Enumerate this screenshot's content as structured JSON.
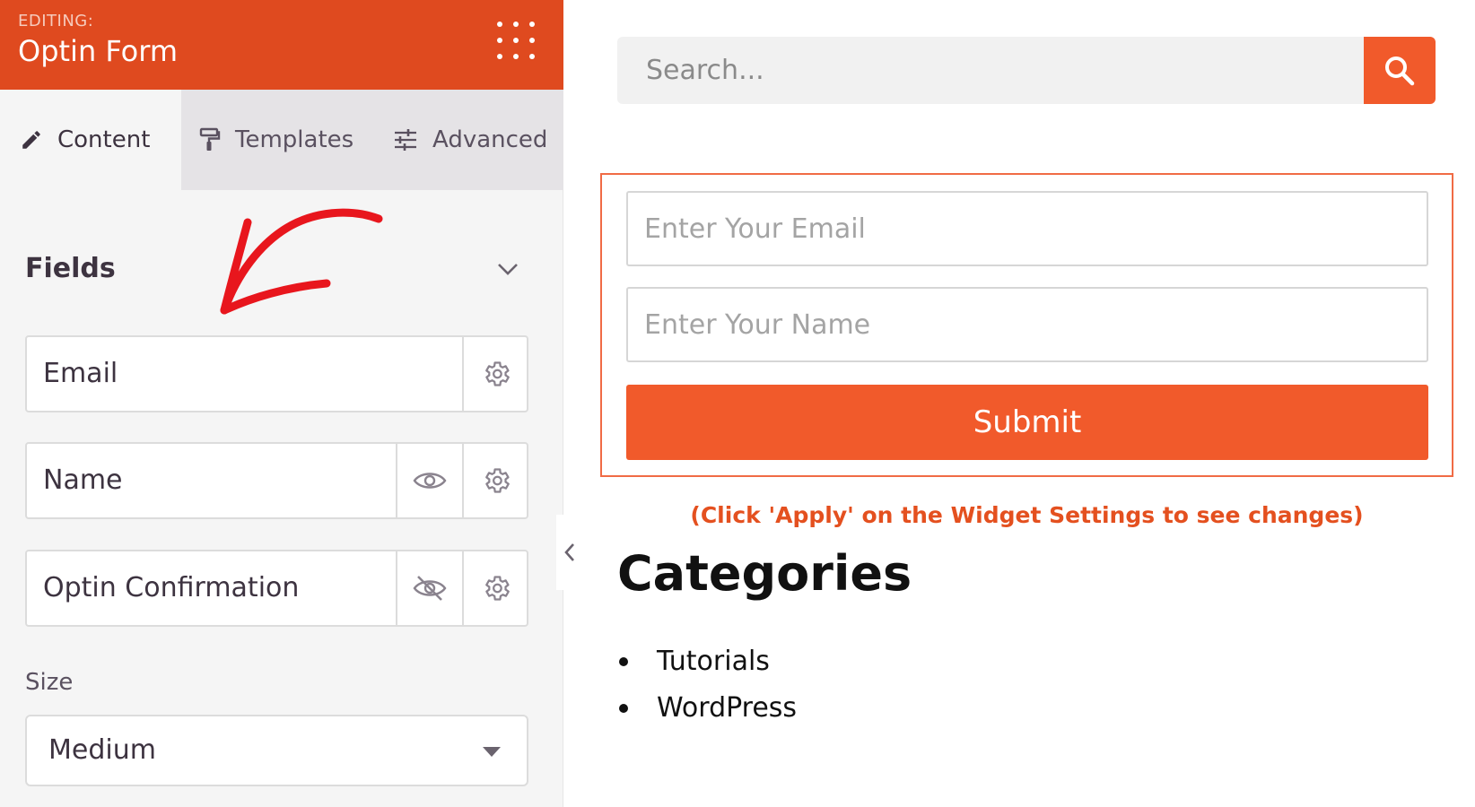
{
  "editor": {
    "editing_label": "EDITING:",
    "title": "Optin Form"
  },
  "tabs": [
    {
      "label": "Content",
      "icon": "pencil-icon",
      "active": true
    },
    {
      "label": "Templates",
      "icon": "paint-roller-icon",
      "active": false
    },
    {
      "label": "Advanced",
      "icon": "sliders-icon",
      "active": false
    }
  ],
  "fields_section": {
    "title": "Fields",
    "items": [
      {
        "label": "Email",
        "visibility_icon": null
      },
      {
        "label": "Name",
        "visibility_icon": "eye-icon"
      },
      {
        "label": "Optin Confirmation",
        "visibility_icon": "eye-slash-icon"
      }
    ]
  },
  "size": {
    "label": "Size",
    "value": "Medium"
  },
  "preview": {
    "search_placeholder": "Search...",
    "email_placeholder": "Enter Your Email",
    "name_placeholder": "Enter Your Name",
    "submit_label": "Submit",
    "apply_note": "(Click 'Apply' on the Widget Settings to see changes)",
    "categories_title": "Categories",
    "categories": [
      "Tutorials",
      "WordPress"
    ]
  },
  "colors": {
    "header_bg": "#df4a1f",
    "accent": "#f15a2b",
    "panel_bg": "#f5f5f5",
    "tab_inactive_bg": "#e5e3e6",
    "annotation_arrow": "#e8161d"
  }
}
